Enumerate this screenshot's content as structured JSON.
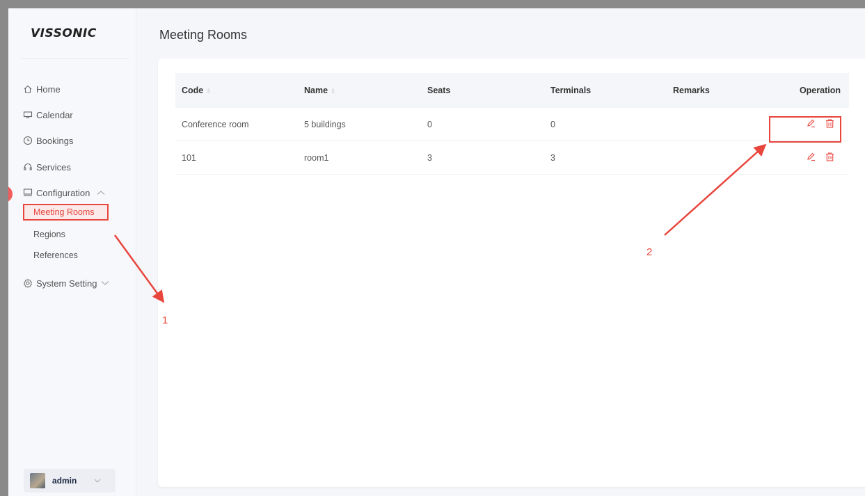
{
  "brand": {
    "logo_text": "VISSONIC"
  },
  "sidebar": {
    "items": [
      {
        "label": "Home",
        "icon": "home-icon"
      },
      {
        "label": "Calendar",
        "icon": "calendar-icon"
      },
      {
        "label": "Bookings",
        "icon": "clock-icon"
      },
      {
        "label": "Services",
        "icon": "headset-icon"
      },
      {
        "label": "Configuration",
        "icon": "monitor-icon",
        "expanded": true
      },
      {
        "label": "System Setting",
        "icon": "gear-icon",
        "expanded": false
      }
    ],
    "config_sub": [
      {
        "label": "Meeting Rooms",
        "active": true
      },
      {
        "label": "Regions"
      },
      {
        "label": "References"
      }
    ]
  },
  "user": {
    "name": "admin"
  },
  "page": {
    "title": "Meeting Rooms"
  },
  "table": {
    "columns": [
      "Code",
      "Name",
      "Seats",
      "Terminals",
      "Remarks",
      "Operation"
    ],
    "sortable": [
      "Code",
      "Name"
    ],
    "rows": [
      {
        "code": "Conference room",
        "name": "5 buildings",
        "seats": "0",
        "terminals": "0",
        "remarks": ""
      },
      {
        "code": "101",
        "name": "room1",
        "seats": "3",
        "terminals": "3",
        "remarks": ""
      }
    ]
  },
  "annotations": {
    "marker1": "1",
    "marker2": "2"
  },
  "colors": {
    "accent": "#e8453c",
    "background": "#f5f6fa",
    "header_bg": "#f5f6f9"
  }
}
